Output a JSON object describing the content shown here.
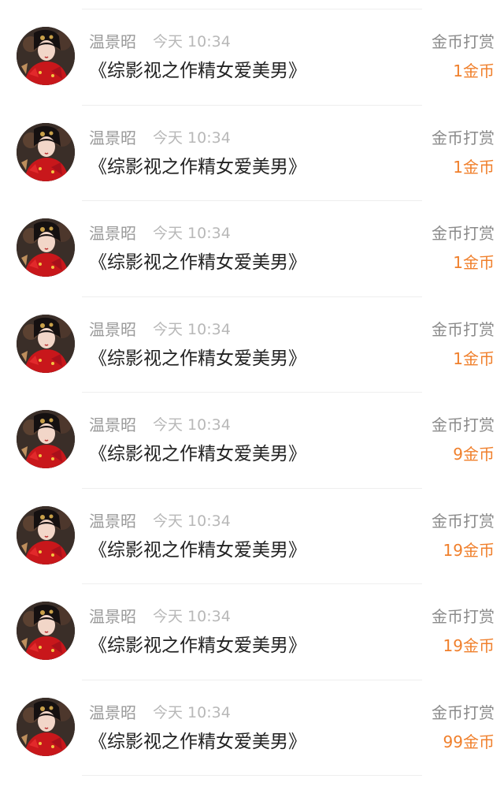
{
  "tip_list": [
    {
      "user_name": "温景昭",
      "time": "今天 10:34",
      "book_title": "《综影视之作精女爱美男》",
      "tip_type": "金币打赏",
      "amount": "1金币",
      "avatar_icon": "user-avatar-photo"
    },
    {
      "user_name": "温景昭",
      "time": "今天 10:34",
      "book_title": "《综影视之作精女爱美男》",
      "tip_type": "金币打赏",
      "amount": "1金币",
      "avatar_icon": "user-avatar-photo"
    },
    {
      "user_name": "温景昭",
      "time": "今天 10:34",
      "book_title": "《综影视之作精女爱美男》",
      "tip_type": "金币打赏",
      "amount": "1金币",
      "avatar_icon": "user-avatar-photo"
    },
    {
      "user_name": "温景昭",
      "time": "今天 10:34",
      "book_title": "《综影视之作精女爱美男》",
      "tip_type": "金币打赏",
      "amount": "1金币",
      "avatar_icon": "user-avatar-photo"
    },
    {
      "user_name": "温景昭",
      "time": "今天 10:34",
      "book_title": "《综影视之作精女爱美男》",
      "tip_type": "金币打赏",
      "amount": "9金币",
      "avatar_icon": "user-avatar-photo"
    },
    {
      "user_name": "温景昭",
      "time": "今天 10:34",
      "book_title": "《综影视之作精女爱美男》",
      "tip_type": "金币打赏",
      "amount": "19金币",
      "avatar_icon": "user-avatar-photo"
    },
    {
      "user_name": "温景昭",
      "time": "今天 10:34",
      "book_title": "《综影视之作精女爱美男》",
      "tip_type": "金币打赏",
      "amount": "19金币",
      "avatar_icon": "user-avatar-photo"
    },
    {
      "user_name": "温景昭",
      "time": "今天 10:34",
      "book_title": "《综影视之作精女爱美男》",
      "tip_type": "金币打赏",
      "amount": "99金币",
      "avatar_icon": "user-avatar-photo"
    }
  ],
  "colors": {
    "amount_accent": "#f07f2b",
    "name_gray": "#9a9a9a",
    "time_gray": "#b8b8b8",
    "title_dark": "#222222",
    "divider": "#eeeeee"
  }
}
